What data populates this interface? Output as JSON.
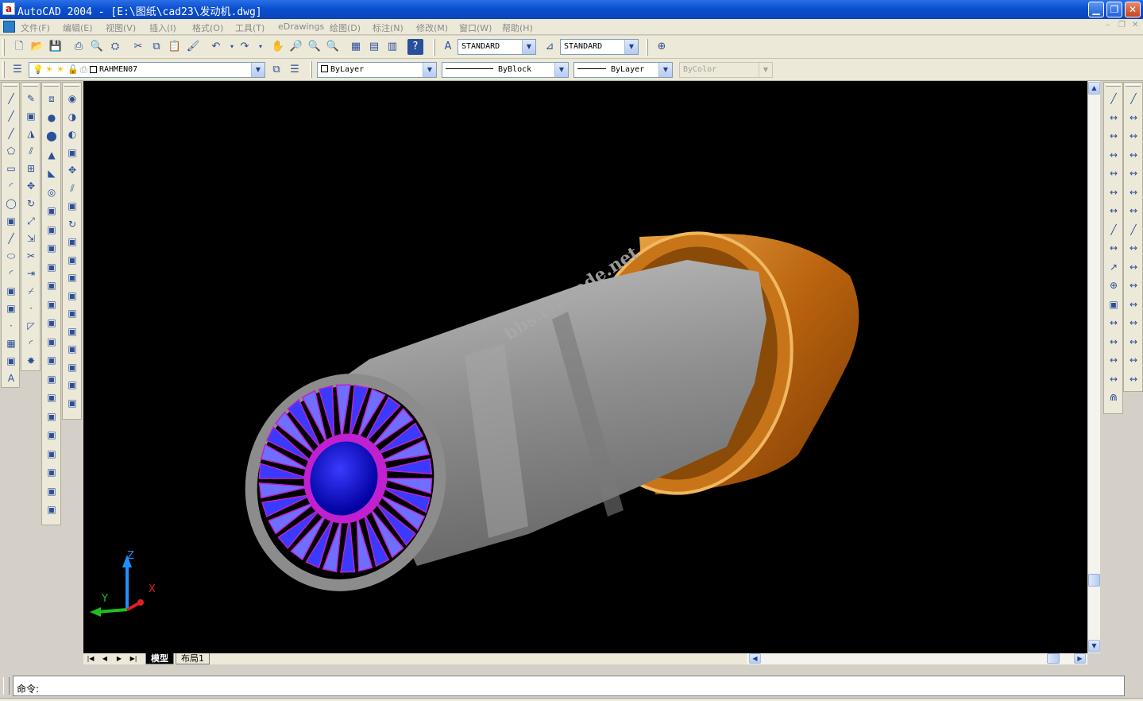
{
  "window": {
    "title": "AutoCAD 2004 - [E:\\图纸\\cad23\\发动机.dwg]",
    "app_icon_letter": "a",
    "minimize_label": "▁",
    "restore_label": "❐",
    "close_label": "✕"
  },
  "menu": {
    "items": [
      "文件(F)",
      "编辑(E)",
      "视图(V)",
      "插入(I)",
      "格式(O)",
      "工具(T)",
      "eDrawings",
      "绘图(D)",
      "标注(N)",
      "修改(M)",
      "窗口(W)",
      "帮助(H)"
    ],
    "mdi_controls": [
      "–",
      "❐",
      "✕"
    ]
  },
  "toolbar": {
    "text_style": "STANDARD",
    "dim_style": "STANDARD",
    "layer": "RAHMEN07",
    "color": "ByLayer",
    "linetype": "ByBlock",
    "lineweight": "ByLayer",
    "plotstyle": "ByColor"
  },
  "icons": {
    "standard": [
      "new-icon",
      "open-icon",
      "save-icon",
      "print-icon",
      "preview-icon",
      "publish-icon",
      "cut-icon",
      "copy-icon",
      "paste-icon",
      "match-properties-icon",
      "undo-icon",
      "redo-icon",
      "pan-icon",
      "zoom-realtime-icon",
      "zoom-window-icon",
      "zoom-previous-icon",
      "properties-icon",
      "design-center-icon",
      "tool-palette-icon",
      "help-icon"
    ],
    "draw": [
      "line-icon",
      "construction-line-icon",
      "polyline-icon",
      "polygon-icon",
      "rectangle-icon",
      "arc-icon",
      "circle-icon",
      "revision-cloud-icon",
      "spline-icon",
      "ellipse-icon",
      "ellipse-arc-icon",
      "insert-block-icon",
      "make-block-icon",
      "point-icon",
      "hatch-icon",
      "region-icon",
      "mtext-icon"
    ],
    "modify": [
      "erase-icon",
      "copy-object-icon",
      "mirror-icon",
      "offset-icon",
      "array-icon",
      "move-icon",
      "rotate-icon",
      "scale-icon",
      "stretch-icon",
      "trim-icon",
      "extend-icon",
      "break-icon",
      "break-at-point-icon",
      "chamfer-icon",
      "fillet-icon",
      "explode-icon"
    ],
    "solids": [
      "box-icon",
      "sphere-icon",
      "cylinder-icon",
      "cone-icon",
      "wedge-icon",
      "torus-icon",
      "extrude-icon",
      "revolve-icon",
      "slice-icon",
      "section-icon",
      "interfere-icon",
      "setup-drawing-icon",
      "shade-icon",
      "render-icon",
      "lights-icon",
      "scene-icon",
      "materials-icon",
      "orbit-icon",
      "zoom-3d-icon",
      "pan-3d-icon",
      "camera-icon",
      "view-3d-icon",
      "solid-edit-icon"
    ],
    "solid_edit": [
      "union-icon",
      "subtract-icon",
      "intersect-icon",
      "extrude-faces-icon",
      "move-faces-icon",
      "offset-faces-icon",
      "delete-faces-icon",
      "rotate-faces-icon",
      "taper-faces-icon",
      "copy-faces-icon",
      "color-faces-icon",
      "copy-edges-icon",
      "color-edges-icon",
      "imprint-icon",
      "clean-icon",
      "separate-icon",
      "shell-icon",
      "check-icon"
    ],
    "dimension_left": [
      "linear-dim-icon",
      "aligned-dim-icon",
      "ordinate-dim-icon",
      "radius-dim-icon",
      "diameter-dim-icon",
      "angular-dim-icon",
      "quick-dim-icon",
      "baseline-dim-icon",
      "continue-dim-icon",
      "leader-icon",
      "tolerance-icon",
      "center-mark-icon",
      "dim-edit-icon",
      "dim-text-edit-icon",
      "dim-update-icon",
      "dim-style-icon",
      "magnet-icon"
    ],
    "dimension_right": [
      "dim-linear-icon",
      "dim-aligned-icon",
      "dim-ordinate-icon",
      "dim-radius-icon",
      "dim-diameter-icon",
      "dim-angular-icon",
      "dim-quick-icon",
      "dim-baseline-icon",
      "dim-continue-icon",
      "dim-leader-icon",
      "dim-tolerance-icon",
      "dim-center-icon",
      "dim-text-icon",
      "dim-edit2-icon",
      "dim-update2-icon",
      "dim-style2-icon"
    ]
  },
  "viewport": {
    "watermark": "bbs.chinade.net",
    "ucs": {
      "z": "Z",
      "y": "Y",
      "x": "X"
    },
    "colors": {
      "background": "#000000",
      "blades": "#3a3aff",
      "blade_edge": "#c020d0",
      "casing": "#9a9a9a",
      "nozzle": "#d88a20"
    }
  },
  "tabs": {
    "nav": [
      "|◀",
      "◀",
      "▶",
      "▶|"
    ],
    "model": "模型",
    "layout": "布局1"
  },
  "command": {
    "prompt": "命令:"
  }
}
